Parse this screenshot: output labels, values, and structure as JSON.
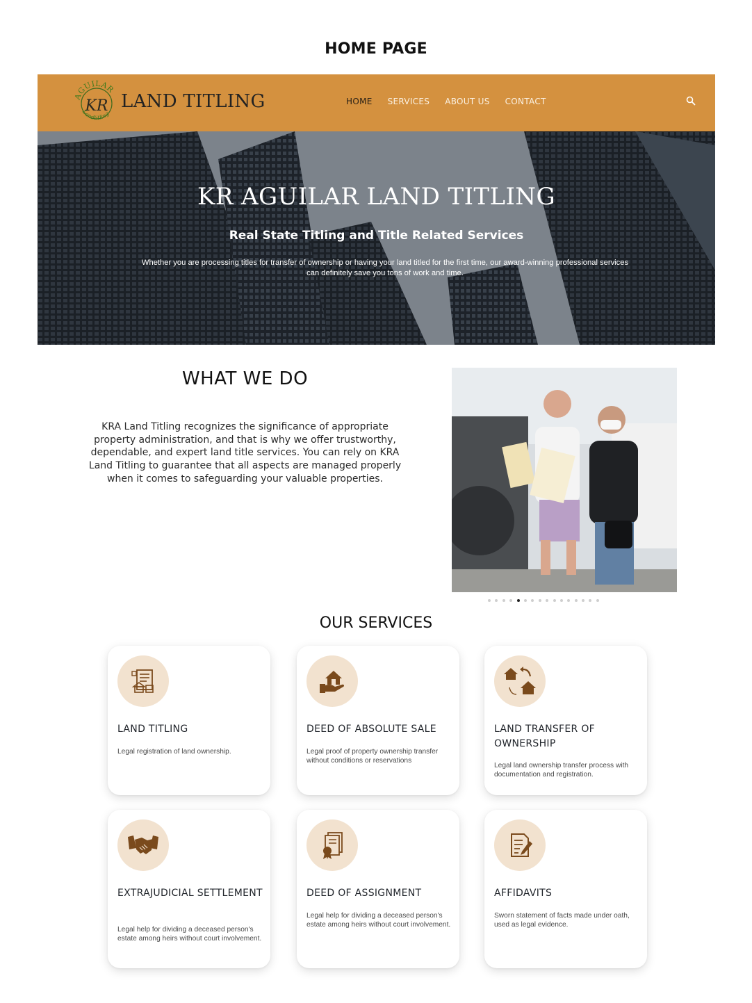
{
  "page": {
    "title": "HOME PAGE"
  },
  "header": {
    "logo_text": "LAND TITLING",
    "logo_mark_text": {
      "arc": "AGUILAR",
      "initials": "KR",
      "sub": "Landtitling"
    },
    "nav": [
      "HOME",
      "SERVICES",
      "ABOUT US",
      "CONTACT"
    ],
    "active_nav": "HOME",
    "accent_color": "#d4913f"
  },
  "hero": {
    "title": "KR AGUILAR LAND TITLING",
    "subtitle": "Real State Titling and Title Related Services",
    "text": "Whether you are processing titles for transfer of ownership or having your land titled for the first time, our award-winning professional services can definitely save you tons of work and time."
  },
  "what_we_do": {
    "heading": "WHAT WE DO",
    "text": "KRA Land Titling recognizes the significance of appropriate property administration, and that is why we offer trustworthy, dependable, and expert land title services. You can rely on KRA Land Titling to guarantee that all aspects are managed properly when it comes to safeguarding your valuable properties.",
    "carousel": {
      "total": 16,
      "active_index": 4
    }
  },
  "services": {
    "heading": "OUR SERVICES",
    "icon_bg_color": "#f2e2cf",
    "icon_color": "#7a4a1c",
    "items": [
      {
        "title": "LAND TITLING",
        "desc": "Legal registration of land ownership.",
        "icon": "land-document-icon"
      },
      {
        "title": "DEED OF ABSOLUTE SALE",
        "desc": "Legal proof of property ownership transfer without conditions or reservations",
        "icon": "house-hand-icon"
      },
      {
        "title": "LAND TRANSFER OF OWNERSHIP",
        "desc": "Legal land ownership transfer process with documentation and registration.",
        "icon": "house-exchange-icon"
      },
      {
        "title": "EXTRAJUDICIAL SETTLEMENT",
        "desc": "Legal help for dividing a deceased person's estate among heirs without court involvement.",
        "icon": "handshake-icon"
      },
      {
        "title": "DEED OF ASSIGNMENT",
        "desc": "Legal help for dividing a deceased person's estate among heirs without court involvement.",
        "icon": "certificate-icon"
      },
      {
        "title": "AFFIDAVITS",
        "desc": "Sworn statement of facts made under oath, used as legal evidence.",
        "icon": "document-pen-icon"
      }
    ]
  }
}
